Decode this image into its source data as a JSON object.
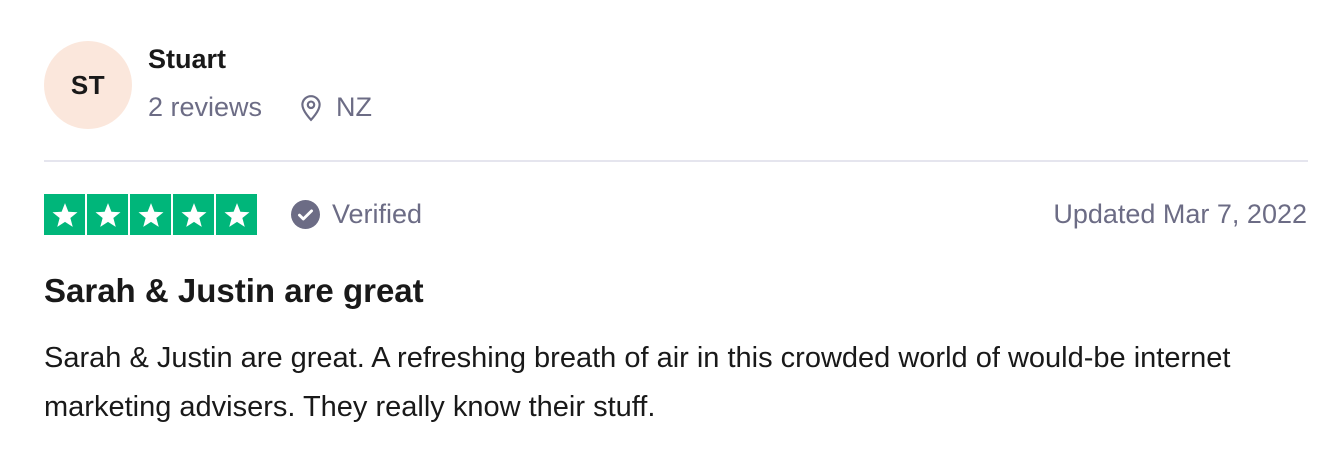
{
  "reviewer": {
    "initials": "ST",
    "name": "Stuart",
    "review_count": "2 reviews",
    "location": "NZ",
    "location_icon": "map-pin-icon",
    "avatar_color": "#fbe7dc"
  },
  "review": {
    "rating": 5,
    "rating_max": 5,
    "star_color": "#00b67a",
    "verified_label": "Verified",
    "verified_icon": "check-circle-icon",
    "date": "Updated Mar 7, 2022",
    "title": "Sarah & Justin are great",
    "body": "Sarah & Justin are great. A refreshing breath of air in this crowded world of would-be internet marketing advisers. They really know their stuff."
  }
}
